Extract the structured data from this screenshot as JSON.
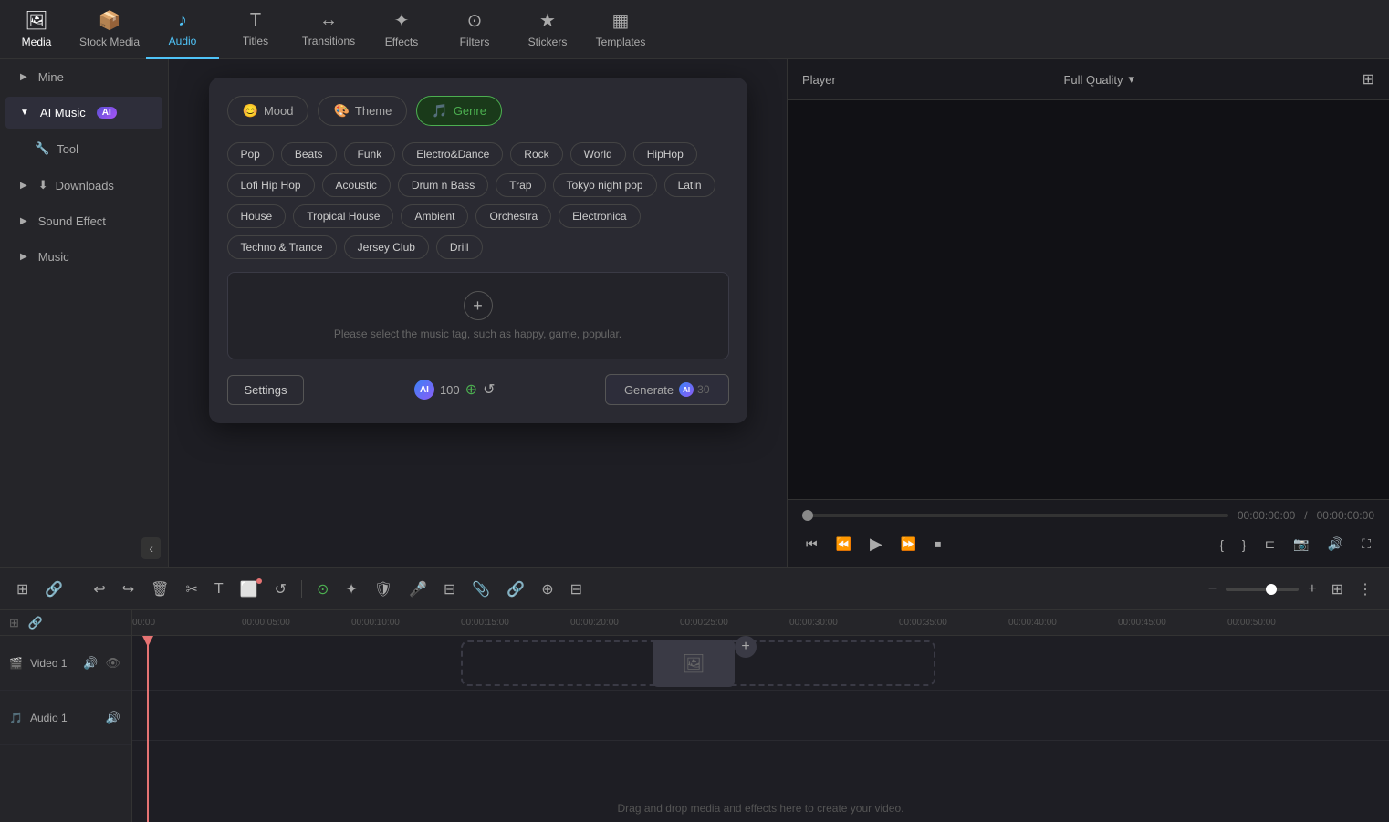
{
  "nav": {
    "items": [
      {
        "id": "media",
        "label": "Media",
        "icon": "🖼",
        "active": false
      },
      {
        "id": "stock-media",
        "label": "Stock Media",
        "icon": "📦",
        "active": false
      },
      {
        "id": "audio",
        "label": "Audio",
        "icon": "♪",
        "active": true
      },
      {
        "id": "titles",
        "label": "Titles",
        "icon": "T",
        "active": false
      },
      {
        "id": "transitions",
        "label": "Transitions",
        "icon": "↔",
        "active": false
      },
      {
        "id": "effects",
        "label": "Effects",
        "icon": "✦",
        "active": false
      },
      {
        "id": "filters",
        "label": "Filters",
        "icon": "⊙",
        "active": false
      },
      {
        "id": "stickers",
        "label": "Stickers",
        "icon": "★",
        "active": false
      },
      {
        "id": "templates",
        "label": "Templates",
        "icon": "▦",
        "active": false
      }
    ]
  },
  "sidebar": {
    "items": [
      {
        "id": "mine",
        "label": "Mine",
        "expanded": false,
        "hasChevron": true
      },
      {
        "id": "ai-music",
        "label": "AI Music",
        "expanded": true,
        "hasChevron": true,
        "badge": "AI"
      },
      {
        "id": "tool",
        "label": "Tool",
        "expanded": false,
        "hasChevron": false,
        "icon": "🔧"
      },
      {
        "id": "downloads",
        "label": "Downloads",
        "expanded": false,
        "hasChevron": true,
        "icon": "⬇"
      },
      {
        "id": "sound-effect",
        "label": "Sound Effect",
        "expanded": false,
        "hasChevron": true
      },
      {
        "id": "music",
        "label": "Music",
        "expanded": false,
        "hasChevron": true
      }
    ]
  },
  "modal": {
    "tabs": [
      {
        "id": "mood",
        "label": "Mood",
        "icon": "😊",
        "active": false
      },
      {
        "id": "theme",
        "label": "Theme",
        "icon": "🎨",
        "active": false
      },
      {
        "id": "genre",
        "label": "Genre",
        "icon": "🎵",
        "active": true
      }
    ],
    "genres": [
      {
        "id": "pop",
        "label": "Pop",
        "selected": false
      },
      {
        "id": "beats",
        "label": "Beats",
        "selected": false
      },
      {
        "id": "funk",
        "label": "Funk",
        "selected": false
      },
      {
        "id": "electro-dance",
        "label": "Electro&Dance",
        "selected": false
      },
      {
        "id": "rock",
        "label": "Rock",
        "selected": false
      },
      {
        "id": "world",
        "label": "World",
        "selected": false
      },
      {
        "id": "hiphop",
        "label": "HipHop",
        "selected": false
      },
      {
        "id": "lofi-hip-hop",
        "label": "Lofi Hip Hop",
        "selected": false
      },
      {
        "id": "acoustic",
        "label": "Acoustic",
        "selected": false
      },
      {
        "id": "drum-n-bass",
        "label": "Drum n Bass",
        "selected": false
      },
      {
        "id": "trap",
        "label": "Trap",
        "selected": false
      },
      {
        "id": "tokyo-night-pop",
        "label": "Tokyo night pop",
        "selected": false
      },
      {
        "id": "latin",
        "label": "Latin",
        "selected": false
      },
      {
        "id": "house",
        "label": "House",
        "selected": false
      },
      {
        "id": "tropical-house",
        "label": "Tropical House",
        "selected": false
      },
      {
        "id": "ambient",
        "label": "Ambient",
        "selected": false
      },
      {
        "id": "orchestra",
        "label": "Orchestra",
        "selected": false
      },
      {
        "id": "electronica",
        "label": "Electronica",
        "selected": false
      },
      {
        "id": "techno-trance",
        "label": "Techno & Trance",
        "selected": false
      },
      {
        "id": "jersey-club",
        "label": "Jersey Club",
        "selected": false
      },
      {
        "id": "drill",
        "label": "Drill",
        "selected": false
      }
    ],
    "selection_placeholder": "Please select the music tag, such as happy, game, popular.",
    "settings_label": "Settings",
    "credits_value": "100",
    "generate_label": "Generate",
    "generate_credits": "30"
  },
  "preview": {
    "player_label": "Player",
    "quality_label": "Full Quality",
    "time_current": "00:00:00:00",
    "time_total": "00:00:00:00"
  },
  "timeline": {
    "ruler_marks": [
      "00:00",
      "00:00:05:00",
      "00:00:10:00",
      "00:00:15:00",
      "00:00:20:00",
      "00:00:25:00",
      "00:00:30:00",
      "00:00:35:00",
      "00:00:40:00",
      "00:00:45:00",
      "00:00:50:00"
    ],
    "tracks": [
      {
        "id": "video-1",
        "label": "Video 1",
        "icon": "🎬"
      },
      {
        "id": "audio-1",
        "label": "Audio 1",
        "icon": "🎵"
      }
    ],
    "drag_hint": "Drag and drop media and effects here to create your video."
  }
}
